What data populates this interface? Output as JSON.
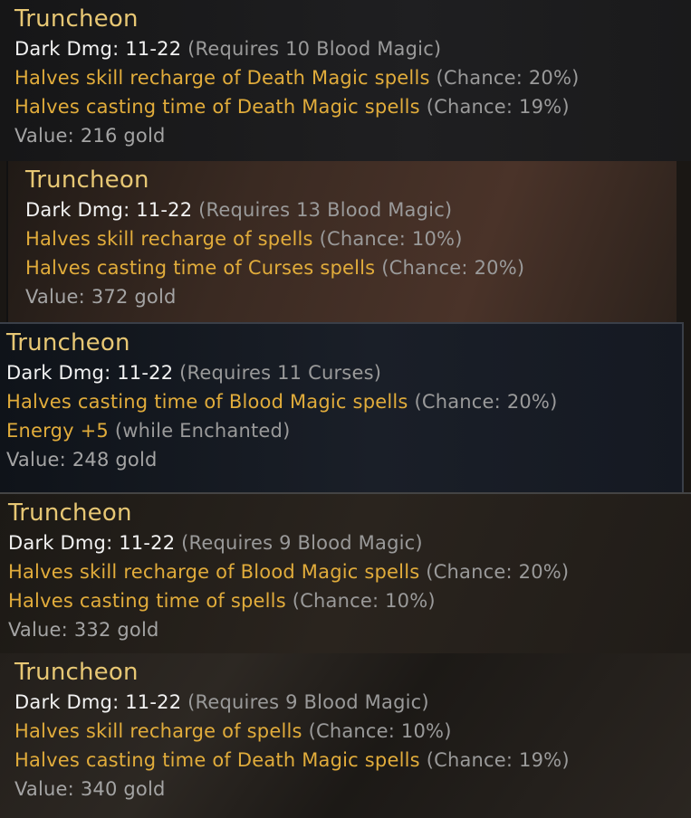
{
  "tooltips": [
    {
      "title": "Truncheon",
      "damage_label": "Dark Dmg:",
      "damage_value": "11-22",
      "requirement": "(Requires 10 Blood Magic)",
      "mod1_text": "Halves skill recharge of Death Magic spells",
      "mod1_note": "(Chance: 20%)",
      "mod2_text": "Halves casting time of Death Magic spells",
      "mod2_note": "(Chance: 19%)",
      "value": "Value: 216 gold"
    },
    {
      "title": "Truncheon",
      "damage_label": "Dark Dmg:",
      "damage_value": "11-22",
      "requirement": "(Requires 13 Blood Magic)",
      "mod1_text": "Halves skill recharge of spells",
      "mod1_note": "(Chance: 10%)",
      "mod2_text": "Halves casting time of Curses spells",
      "mod2_note": "(Chance: 20%)",
      "value": "Value: 372 gold"
    },
    {
      "title": "Truncheon",
      "damage_label": "Dark Dmg:",
      "damage_value": "11-22",
      "requirement": "(Requires 11 Curses)",
      "mod1_text": "Halves casting time of Blood Magic spells",
      "mod1_note": "(Chance: 20%)",
      "mod2_text": "Energy +5",
      "mod2_note": "(while Enchanted)",
      "value": "Value: 248 gold"
    },
    {
      "title": "Truncheon",
      "damage_label": "Dark Dmg:",
      "damage_value": "11-22",
      "requirement": "(Requires 9 Blood Magic)",
      "mod1_text": "Halves skill recharge of Blood Magic spells",
      "mod1_note": "(Chance: 20%)",
      "mod2_text": "Halves casting time of spells",
      "mod2_note": "(Chance: 10%)",
      "value": "Value: 332 gold"
    },
    {
      "title": "Truncheon",
      "damage_label": "Dark Dmg:",
      "damage_value": "11-22",
      "requirement": "(Requires 9 Blood Magic)",
      "mod1_text": "Halves skill recharge of spells",
      "mod1_note": "(Chance: 10%)",
      "mod2_text": "Halves casting time of Death Magic spells",
      "mod2_note": "(Chance: 19%)",
      "value": "Value: 340 gold"
    }
  ],
  "colors": {
    "title": "#e7c774",
    "damage": "#f2f2f2",
    "modifier": "#e1ac3b",
    "note": "#9a9a9a",
    "value": "#a4a4a4"
  }
}
